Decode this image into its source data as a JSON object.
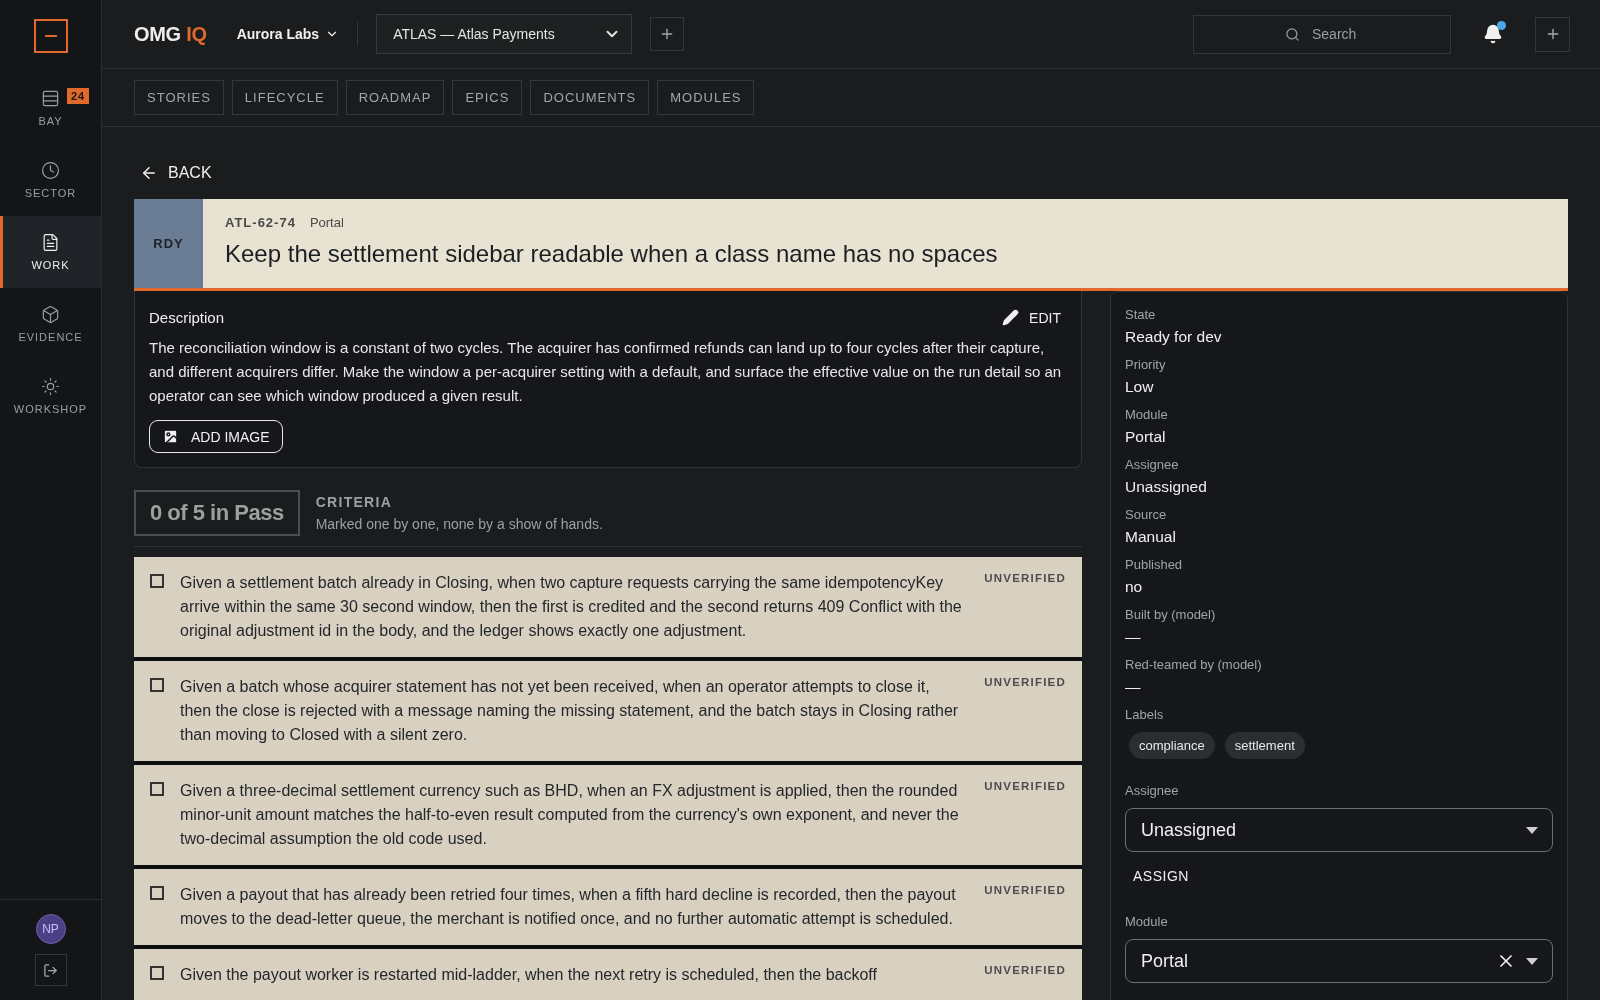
{
  "sidebar": {
    "items": [
      {
        "label": "BAY",
        "badge": "24",
        "selected": false
      },
      {
        "label": "SECTOR",
        "selected": false
      },
      {
        "label": "WORK",
        "selected": true
      },
      {
        "label": "EVIDENCE",
        "selected": false
      },
      {
        "label": "WORKSHOP",
        "selected": false
      }
    ],
    "user_initials": "NP"
  },
  "header": {
    "brand": "OMG",
    "brand_accent": "IQ",
    "org": "Aurora Labs",
    "project": "ATLAS — Atlas Payments",
    "search": {
      "placeholder": "Search"
    },
    "unread": true
  },
  "tabs": [
    {
      "label": "STORIES",
      "selected": false
    },
    {
      "label": "LIFECYCLE",
      "selected": false
    },
    {
      "label": "ROADMAP",
      "selected": false
    },
    {
      "label": "EPICS",
      "selected": false
    },
    {
      "label": "DOCUMENTS",
      "selected": false
    },
    {
      "label": "MODULES",
      "selected": false
    }
  ],
  "back": "BACK",
  "story": {
    "status": "RDY",
    "key": "ATL-62-74",
    "module": "Portal",
    "title": "Keep the settlement sidebar readable when a class name has no spaces"
  },
  "description": {
    "heading": "Description",
    "edit": "EDIT",
    "text": "The reconciliation window is a constant of two cycles. The acquirer has confirmed refunds can land up to four cycles after their capture, and different acquirers differ. Make the window a per-acquirer setting with a default, and surface the effective value on the run detail so an operator can see which window produced a given result.",
    "add_image": "ADD IMAGE"
  },
  "criteria": {
    "summary": "0 of 5 in Pass",
    "heading": "CRITERIA",
    "subtitle": "Marked one by one, none by a show of hands.",
    "items": [
      {
        "text": "Given a settlement batch already in Closing, when two capture requests carrying the same idempotencyKey arrive within the same 30 second window, then the first is credited and the second returns 409 Conflict with the original adjustment id in the body, and the ledger shows exactly one adjustment.",
        "checked": false,
        "status": "UNVERIFIED"
      },
      {
        "text": "Given a batch whose acquirer statement has not yet been received, when an operator attempts to close it, then the close is rejected with a message naming the missing statement, and the batch stays in Closing rather than moving to Closed with a silent zero.",
        "checked": false,
        "status": "UNVERIFIED"
      },
      {
        "text": "Given a three-decimal settlement currency such as BHD, when an FX adjustment is applied, then the rounded minor-unit amount matches the half-to-even result computed from the currency's own exponent, and never the two-decimal assumption the old code used.",
        "checked": false,
        "status": "UNVERIFIED"
      },
      {
        "text": "Given a payout that has already been retried four times, when a fifth hard decline is recorded, then the payout moves to the dead-letter queue, the merchant is notified once, and no further automatic attempt is scheduled.",
        "checked": false,
        "status": "UNVERIFIED"
      },
      {
        "text": "Given the payout worker is restarted mid-ladder, when the next retry is scheduled, then the backoff",
        "checked": false,
        "status": "UNVERIFIED"
      }
    ]
  },
  "details": {
    "fields": [
      {
        "label": "State",
        "value": "Ready for dev"
      },
      {
        "label": "Priority",
        "value": "Low"
      },
      {
        "label": "Module",
        "value": "Portal"
      },
      {
        "label": "Assignee",
        "value": "Unassigned"
      },
      {
        "label": "Source",
        "value": "Manual"
      },
      {
        "label": "Published",
        "value": "no"
      },
      {
        "label": "Built by (model)",
        "value": "—"
      },
      {
        "label": "Red-teamed by (model)",
        "value": "—"
      }
    ],
    "labels_heading": "Labels",
    "labels": [
      "compliance",
      "settlement"
    ],
    "assignee": {
      "label": "Assignee",
      "value": "Unassigned",
      "button": "ASSIGN"
    },
    "module": {
      "label": "Module",
      "value": "Portal",
      "clearable": true
    }
  }
}
